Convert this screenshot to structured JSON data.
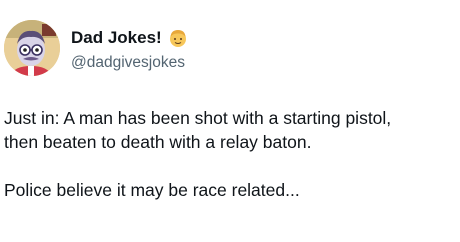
{
  "author": {
    "display_name": "Dad Jokes!",
    "handle": "@dadgivesjokes",
    "avatar_icon": "cartoon-dad-avatar-icon",
    "badge_icon": "man-face-emoji-icon"
  },
  "tweet": {
    "paragraphs": [
      "Just in: A man has been shot with a starting pistol,\nthen beaten to death with a relay baton.",
      "Police believe it may be race related..."
    ]
  },
  "colors": {
    "text": "#0f1419",
    "secondary_text": "#536471",
    "background": "#ffffff"
  }
}
